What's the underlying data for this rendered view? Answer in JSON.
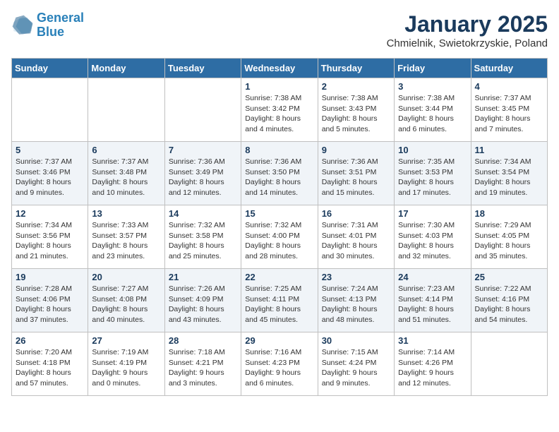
{
  "header": {
    "logo_line1": "General",
    "logo_line2": "Blue",
    "month": "January 2025",
    "location": "Chmielnik, Swietokrzyskie, Poland"
  },
  "weekdays": [
    "Sunday",
    "Monday",
    "Tuesday",
    "Wednesday",
    "Thursday",
    "Friday",
    "Saturday"
  ],
  "weeks": [
    [
      {
        "day": "",
        "info": ""
      },
      {
        "day": "",
        "info": ""
      },
      {
        "day": "",
        "info": ""
      },
      {
        "day": "1",
        "info": "Sunrise: 7:38 AM\nSunset: 3:42 PM\nDaylight: 8 hours\nand 4 minutes."
      },
      {
        "day": "2",
        "info": "Sunrise: 7:38 AM\nSunset: 3:43 PM\nDaylight: 8 hours\nand 5 minutes."
      },
      {
        "day": "3",
        "info": "Sunrise: 7:38 AM\nSunset: 3:44 PM\nDaylight: 8 hours\nand 6 minutes."
      },
      {
        "day": "4",
        "info": "Sunrise: 7:37 AM\nSunset: 3:45 PM\nDaylight: 8 hours\nand 7 minutes."
      }
    ],
    [
      {
        "day": "5",
        "info": "Sunrise: 7:37 AM\nSunset: 3:46 PM\nDaylight: 8 hours\nand 9 minutes."
      },
      {
        "day": "6",
        "info": "Sunrise: 7:37 AM\nSunset: 3:48 PM\nDaylight: 8 hours\nand 10 minutes."
      },
      {
        "day": "7",
        "info": "Sunrise: 7:36 AM\nSunset: 3:49 PM\nDaylight: 8 hours\nand 12 minutes."
      },
      {
        "day": "8",
        "info": "Sunrise: 7:36 AM\nSunset: 3:50 PM\nDaylight: 8 hours\nand 14 minutes."
      },
      {
        "day": "9",
        "info": "Sunrise: 7:36 AM\nSunset: 3:51 PM\nDaylight: 8 hours\nand 15 minutes."
      },
      {
        "day": "10",
        "info": "Sunrise: 7:35 AM\nSunset: 3:53 PM\nDaylight: 8 hours\nand 17 minutes."
      },
      {
        "day": "11",
        "info": "Sunrise: 7:34 AM\nSunset: 3:54 PM\nDaylight: 8 hours\nand 19 minutes."
      }
    ],
    [
      {
        "day": "12",
        "info": "Sunrise: 7:34 AM\nSunset: 3:56 PM\nDaylight: 8 hours\nand 21 minutes."
      },
      {
        "day": "13",
        "info": "Sunrise: 7:33 AM\nSunset: 3:57 PM\nDaylight: 8 hours\nand 23 minutes."
      },
      {
        "day": "14",
        "info": "Sunrise: 7:32 AM\nSunset: 3:58 PM\nDaylight: 8 hours\nand 25 minutes."
      },
      {
        "day": "15",
        "info": "Sunrise: 7:32 AM\nSunset: 4:00 PM\nDaylight: 8 hours\nand 28 minutes."
      },
      {
        "day": "16",
        "info": "Sunrise: 7:31 AM\nSunset: 4:01 PM\nDaylight: 8 hours\nand 30 minutes."
      },
      {
        "day": "17",
        "info": "Sunrise: 7:30 AM\nSunset: 4:03 PM\nDaylight: 8 hours\nand 32 minutes."
      },
      {
        "day": "18",
        "info": "Sunrise: 7:29 AM\nSunset: 4:05 PM\nDaylight: 8 hours\nand 35 minutes."
      }
    ],
    [
      {
        "day": "19",
        "info": "Sunrise: 7:28 AM\nSunset: 4:06 PM\nDaylight: 8 hours\nand 37 minutes."
      },
      {
        "day": "20",
        "info": "Sunrise: 7:27 AM\nSunset: 4:08 PM\nDaylight: 8 hours\nand 40 minutes."
      },
      {
        "day": "21",
        "info": "Sunrise: 7:26 AM\nSunset: 4:09 PM\nDaylight: 8 hours\nand 43 minutes."
      },
      {
        "day": "22",
        "info": "Sunrise: 7:25 AM\nSunset: 4:11 PM\nDaylight: 8 hours\nand 45 minutes."
      },
      {
        "day": "23",
        "info": "Sunrise: 7:24 AM\nSunset: 4:13 PM\nDaylight: 8 hours\nand 48 minutes."
      },
      {
        "day": "24",
        "info": "Sunrise: 7:23 AM\nSunset: 4:14 PM\nDaylight: 8 hours\nand 51 minutes."
      },
      {
        "day": "25",
        "info": "Sunrise: 7:22 AM\nSunset: 4:16 PM\nDaylight: 8 hours\nand 54 minutes."
      }
    ],
    [
      {
        "day": "26",
        "info": "Sunrise: 7:20 AM\nSunset: 4:18 PM\nDaylight: 8 hours\nand 57 minutes."
      },
      {
        "day": "27",
        "info": "Sunrise: 7:19 AM\nSunset: 4:19 PM\nDaylight: 9 hours\nand 0 minutes."
      },
      {
        "day": "28",
        "info": "Sunrise: 7:18 AM\nSunset: 4:21 PM\nDaylight: 9 hours\nand 3 minutes."
      },
      {
        "day": "29",
        "info": "Sunrise: 7:16 AM\nSunset: 4:23 PM\nDaylight: 9 hours\nand 6 minutes."
      },
      {
        "day": "30",
        "info": "Sunrise: 7:15 AM\nSunset: 4:24 PM\nDaylight: 9 hours\nand 9 minutes."
      },
      {
        "day": "31",
        "info": "Sunrise: 7:14 AM\nSunset: 4:26 PM\nDaylight: 9 hours\nand 12 minutes."
      },
      {
        "day": "",
        "info": ""
      }
    ]
  ]
}
